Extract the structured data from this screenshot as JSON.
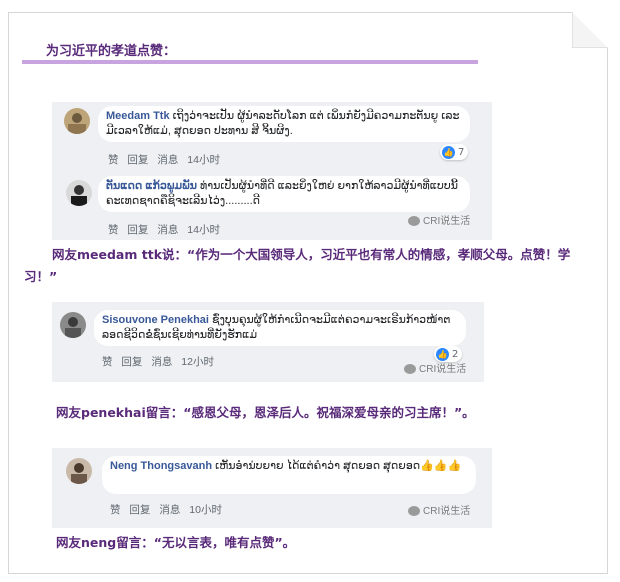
{
  "heading": "为习近平的孝道点赞：",
  "watermark": "CRI说生活",
  "colors": {
    "accent": "#5a2a7a",
    "rule": "#c7a3e0",
    "link": "#385898",
    "like": "#2d88ff"
  },
  "comments": [
    {
      "name": "Meedam Ttk",
      "text": "ເຖິງວ່າຈະເປັນ ຜູ້ນຳລະດັບໂລກ ແຕ່ ເພິ່ນກໍຍັງມີຄວາມກະຕັນຍູ ເລະມີເວລາໃຫ້ແມ່, ສຸດຍອດ ປະທານ ສີ ຈິ້ນຜິງ.",
      "actions": [
        "赞",
        "回复",
        "消息",
        "14小时"
      ],
      "reactions": "7"
    },
    {
      "name": "ຕັນແດດ ແກ້ວພູມພັນ",
      "text": "ທ່ານເປັນຜູ້ນຳທີ່ດີ ແລະຍິ່ງໃຫຍ່ ຍາກໃຫ້ລາວມີຜູ້ນຳທີ່ແບບນີ້ຄະເທດຊາດຄືຊິຈະເລີນໄວ່ງ.........ດີ",
      "actions": [
        "赞",
        "回复",
        "消息",
        "14小时"
      ]
    },
    {
      "name": "Sisouvone Penekhai",
      "text": "ຊົ່ງບຸນຄຸນຜູ້ໃຫ້ກຳເນີດຈະມີແຕ່ຄວາມຈະເຣີນກ້າວໜ້າຕລອດຊີວິດຂໍ່ຊົ່ນເຊີຍທ່ານທີ່ຍັງຮັກແມ່",
      "actions": [
        "赞",
        "回复",
        "消息",
        "12小时"
      ],
      "reactions": "2"
    },
    {
      "name": "Neng Thongsavanh",
      "text": "ເຫັນອຳນ່ບຍາຍ ໄດ້ແຕ່ຄຳວ່າ ສຸດຍອດ ສຸດຍອດ👍👍👍",
      "actions": [
        "赞",
        "回复",
        "消息",
        "10小时"
      ]
    }
  ],
  "captions": [
    "网友meedam ttk说：“作为一个大国领导人，习近平也有常人的情感，孝顺父母。点赞！学习！”",
    "网友penekhai留言：“感恩父母，恩泽后人。祝福深爱母亲的习主席！”。",
    "网友neng留言：“无以言表，唯有点赞”。"
  ]
}
